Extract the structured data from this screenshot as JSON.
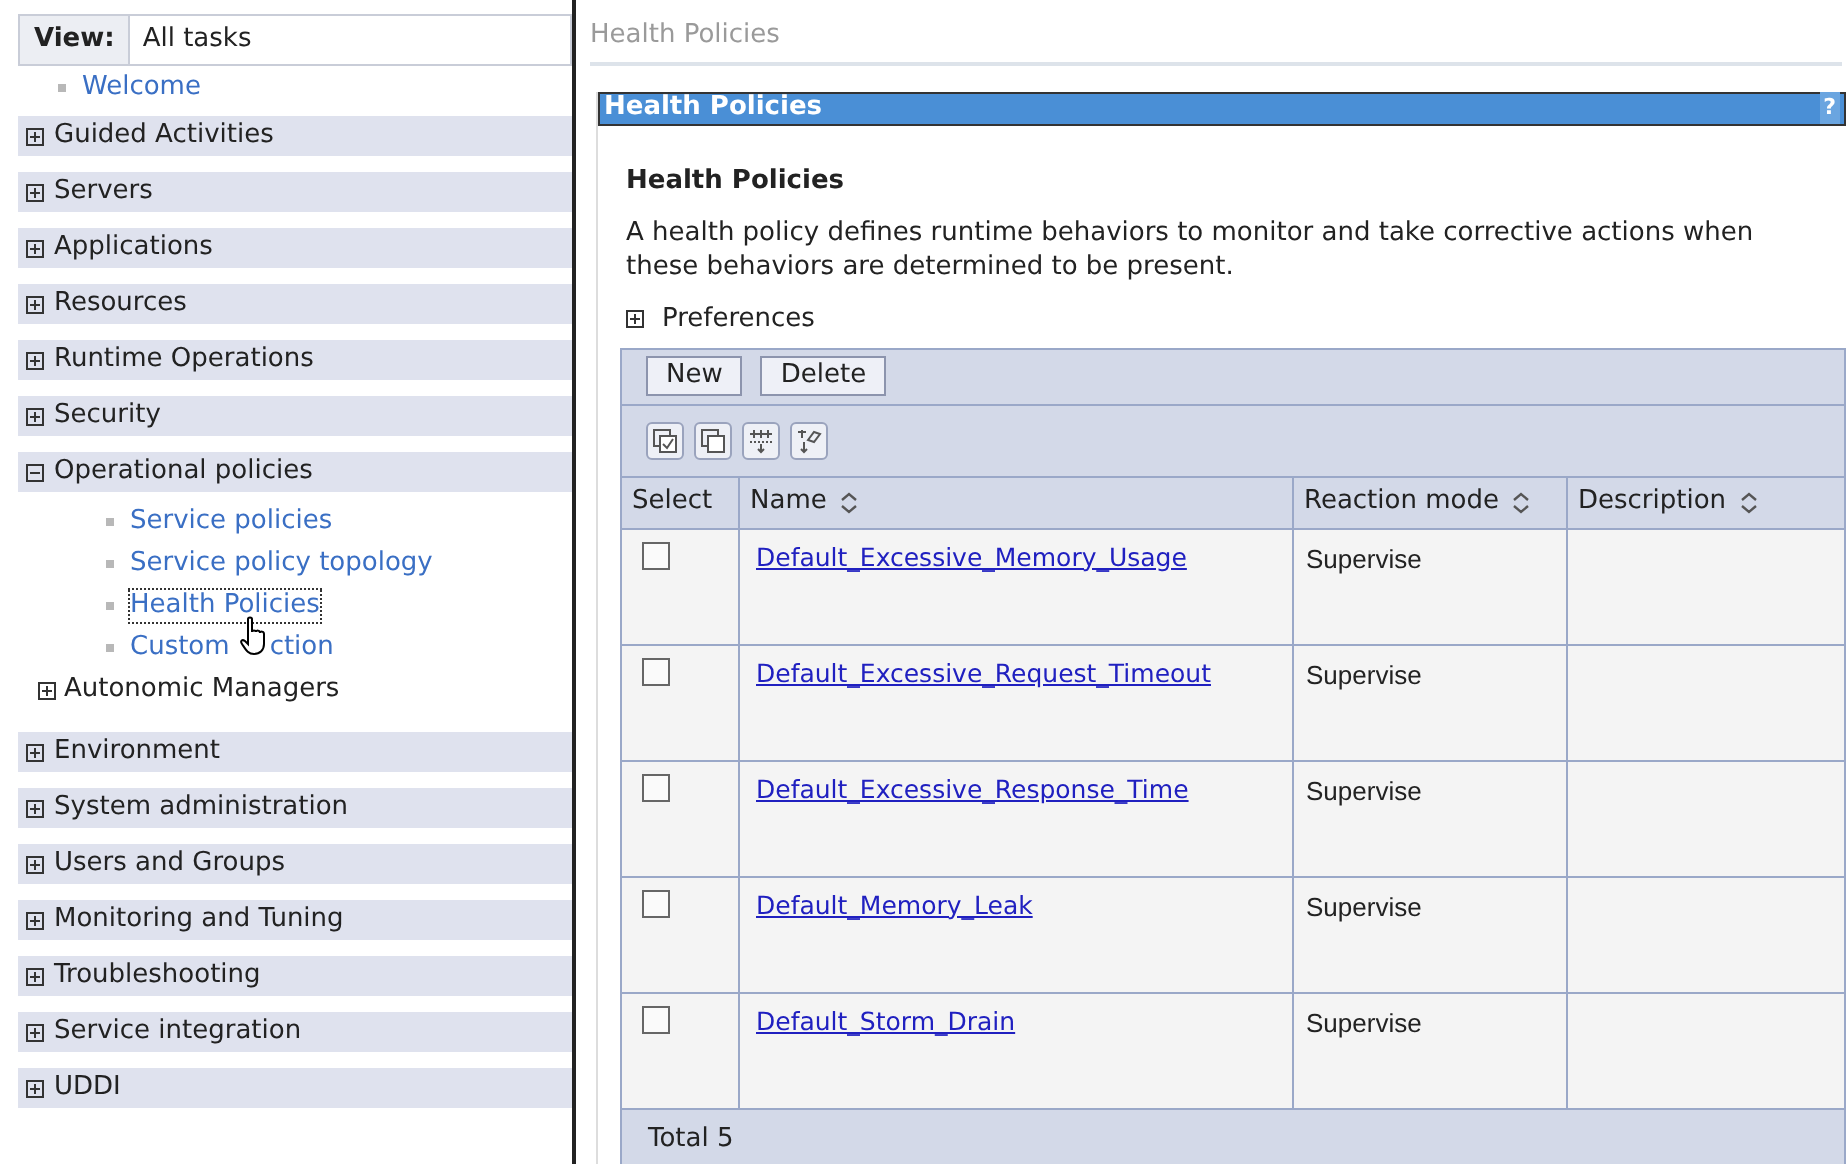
{
  "sidebar": {
    "view_label": "View:",
    "view_value": "All tasks",
    "welcome": "Welcome",
    "groups": [
      {
        "label": "Guided Activities",
        "expanded": false
      },
      {
        "label": "Servers",
        "expanded": false
      },
      {
        "label": "Applications",
        "expanded": false
      },
      {
        "label": "Resources",
        "expanded": false
      },
      {
        "label": "Runtime Operations",
        "expanded": false
      },
      {
        "label": "Security",
        "expanded": false
      },
      {
        "label": "Operational policies",
        "expanded": true,
        "children": [
          {
            "kind": "link",
            "label": "Service policies",
            "selected": false
          },
          {
            "kind": "link",
            "label": "Service policy topology",
            "selected": false
          },
          {
            "kind": "link",
            "label": "Health Policies",
            "selected": true
          },
          {
            "kind": "link",
            "label": "Custom",
            "label_after_cursor": "ction",
            "selected": false
          },
          {
            "kind": "group",
            "label": "Autonomic Managers",
            "expanded": false
          }
        ]
      },
      {
        "label": "Environment",
        "expanded": false
      },
      {
        "label": "System administration",
        "expanded": false
      },
      {
        "label": "Users and Groups",
        "expanded": false
      },
      {
        "label": "Monitoring and Tuning",
        "expanded": false
      },
      {
        "label": "Troubleshooting",
        "expanded": false
      },
      {
        "label": "Service integration",
        "expanded": false
      },
      {
        "label": "UDDI",
        "expanded": false
      }
    ]
  },
  "breadcrumb": "Health Policies",
  "panel": {
    "title": "Health Policies",
    "help": "?",
    "heading": "Health Policies",
    "description": "A health policy defines runtime behaviors to monitor and take corrective actions when these behaviors are determined to be present.",
    "preferences": {
      "label": "Preferences",
      "expanded": false
    },
    "buttons": [
      "New",
      "Delete"
    ],
    "table": {
      "columns": [
        {
          "label": "Select",
          "sortable": false
        },
        {
          "label": "Name",
          "sortable": true
        },
        {
          "label": "Reaction mode",
          "sortable": true
        },
        {
          "label": "Description",
          "sortable": true
        }
      ],
      "rows": [
        {
          "checked": false,
          "name": "Default_Excessive_Memory_Usage",
          "reaction_mode": "Supervise"
        },
        {
          "checked": false,
          "name": "Default_Excessive_Request_Timeout",
          "reaction_mode": "Supervise"
        },
        {
          "checked": false,
          "name": "Default_Excessive_Response_Time",
          "reaction_mode": "Supervise"
        },
        {
          "checked": false,
          "name": "Default_Memory_Leak",
          "reaction_mode": "Supervise"
        },
        {
          "checked": false,
          "name": "Default_Storm_Drain",
          "reaction_mode": "Supervise"
        }
      ],
      "total": "Total 5"
    }
  }
}
